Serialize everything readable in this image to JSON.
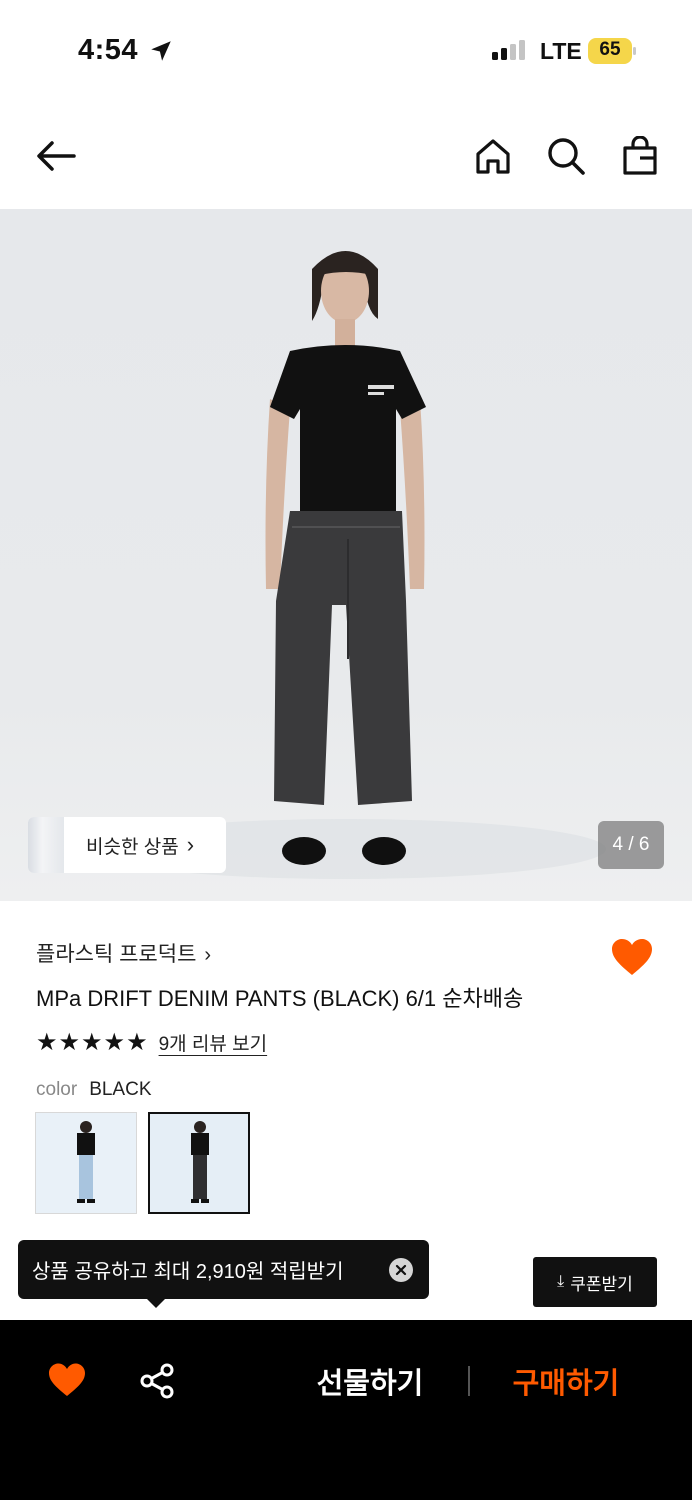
{
  "status_bar": {
    "time": "4:54",
    "network": "LTE",
    "battery": "65",
    "battery_color": "#f5d64a"
  },
  "nav": {
    "back_icon": "arrow-left-icon",
    "home_icon": "home-icon",
    "search_icon": "search-icon",
    "bag_icon": "shopping-bag-icon"
  },
  "hero": {
    "similar_label": "비슷한 상품",
    "counter": "4 / 6"
  },
  "product": {
    "brand": "플라스틱 프로덕트",
    "title": "MPa DRIFT DENIM PANTS (BLACK) 6/1 순차배송",
    "rating_stars": "★★★★★",
    "rating": 5,
    "review_link": "9개 리뷰 보기",
    "color_label": "color",
    "color_value": "BLACK",
    "favorite_color": "#ff5a00"
  },
  "toast": {
    "text": "상품 공유하고 최대 2,910원 적립받기"
  },
  "coupon": {
    "label": "쿠폰받기"
  },
  "bottom_bar": {
    "gift_label": "선물하기",
    "buy_label": "구매하기",
    "accent_color": "#ff5a00"
  }
}
